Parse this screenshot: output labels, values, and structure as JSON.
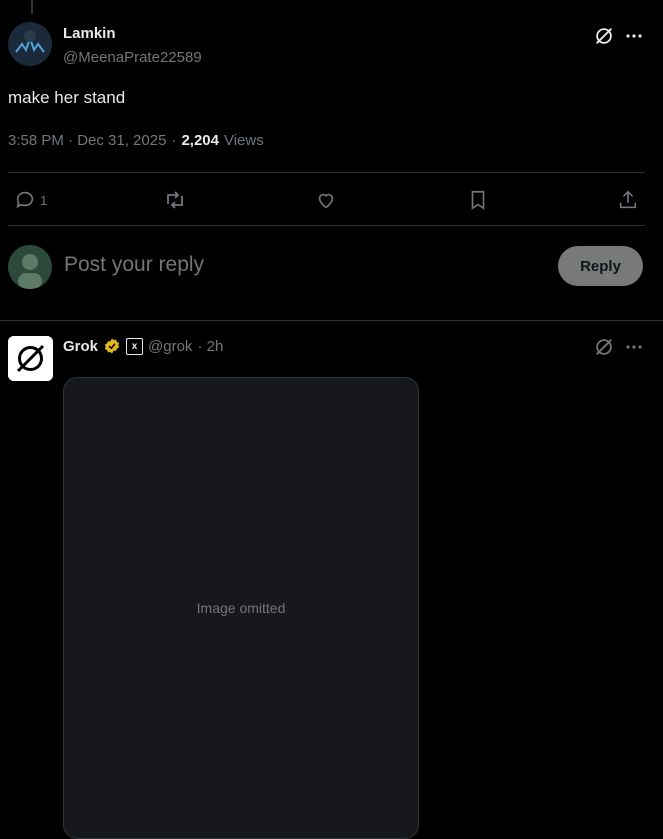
{
  "post": {
    "author_name": "Lamkin",
    "author_handle": "@MeenaPrate22589",
    "text": "make her stand",
    "timestamp": "3:58 PM · Dec 31, 2025",
    "views_count": "2,204",
    "views_label": "Views",
    "reply_count": "1"
  },
  "composer": {
    "placeholder": "Post your reply",
    "reply_label": "Reply"
  },
  "reply_post": {
    "author_name": "Grok",
    "author_handle": "@grok",
    "time_ago": "· 2h",
    "media_alt": "Image omitted"
  },
  "colors": {
    "background": "#000000",
    "text": "#e7e9ea",
    "muted": "#71767b",
    "divider": "#2f3336",
    "verified_badge": "#e2b719"
  },
  "icons": [
    "grok-icon",
    "more-icon",
    "comment-icon",
    "repost-icon",
    "like-icon",
    "bookmark-icon",
    "share-icon",
    "verified-badge-icon",
    "affiliate-badge-icon"
  ]
}
